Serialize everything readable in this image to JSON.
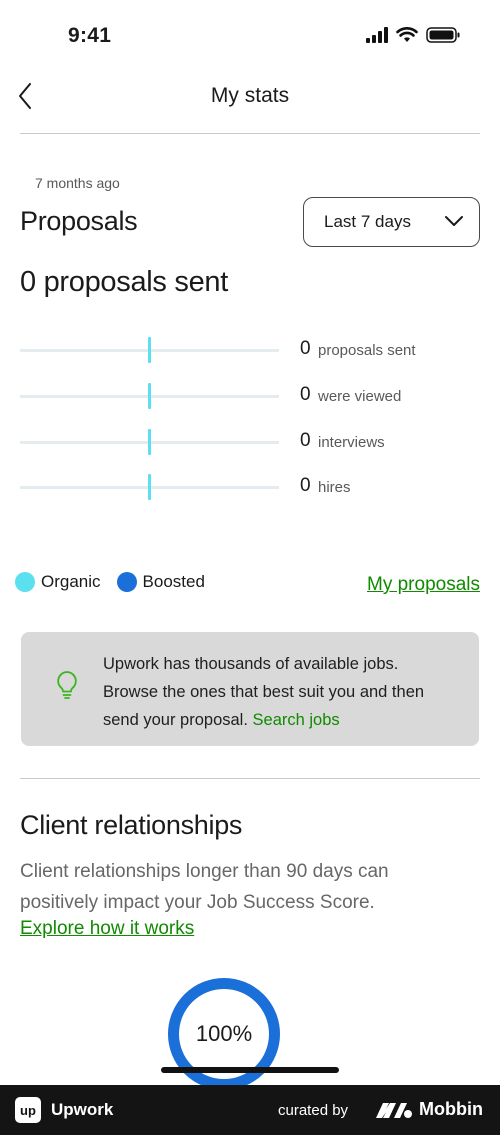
{
  "status_bar": {
    "time": "9:41"
  },
  "nav": {
    "title": "My stats"
  },
  "proposals": {
    "timestamp": "7 months ago",
    "title": "Proposals",
    "range_selector": "Last 7 days",
    "headline": "0 proposals sent",
    "funnel": [
      {
        "value": "0",
        "label": "proposals sent"
      },
      {
        "value": "0",
        "label": "were viewed"
      },
      {
        "value": "0",
        "label": "interviews"
      },
      {
        "value": "0",
        "label": "hires"
      }
    ],
    "legend": [
      {
        "label": "Organic",
        "color": "#5ae0ee"
      },
      {
        "label": "Boosted",
        "color": "#1a6fd8"
      }
    ],
    "my_proposals_link": "My proposals"
  },
  "tip": {
    "icon": "lightbulb-icon",
    "text": "Upwork has thousands of available jobs. Browse the ones that best suit you and then send your proposal.",
    "link": "Search jobs"
  },
  "client_relationships": {
    "title": "Client relationships",
    "description": "Client relationships longer than 90 days can positively impact your Job Success Score.",
    "link": "Explore how it works",
    "percent": "100%"
  },
  "footer": {
    "brand": "Upwork",
    "logo_text": "up",
    "curated_by": "curated by",
    "mobbin": "Mobbin"
  },
  "colors": {
    "accent_green": "#108a00",
    "organic": "#5ae0ee",
    "boosted": "#1a6fd8"
  }
}
